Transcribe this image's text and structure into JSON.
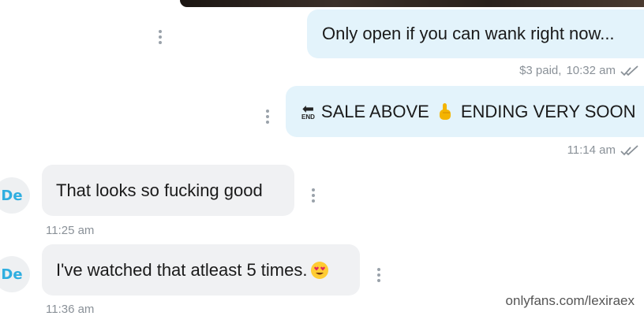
{
  "messages": [
    {
      "text": "Only open if you can wank right now...",
      "meta_price": "$3 paid",
      "meta_sep": ",",
      "meta_time": "10:32 am",
      "status_icon": "double-check-icon"
    },
    {
      "text_before": "SALE ABOVE",
      "text_after": "ENDING VERY SOON",
      "end_arrow_glyph": "⬅",
      "end_label": "END",
      "emoji_icon": "pointing-hand-emoji-icon",
      "meta_time": "11:14 am",
      "status_icon": "double-check-icon"
    },
    {
      "avatar": "De",
      "text": "That looks so fucking good",
      "meta_time": "11:25 am"
    },
    {
      "avatar": "De",
      "text": "I've watched that atleast 5 times.",
      "emoji_icon": "heart-eyes-emoji-icon",
      "meta_time": "11:36 am"
    }
  ],
  "watermark": "onlyfans.com/lexiraex",
  "colors": {
    "outgoing_bubble": "#e3f3fb",
    "incoming_bubble": "#f0f1f3",
    "avatar_text": "#2faee0",
    "meta_text": "#8a9198"
  }
}
